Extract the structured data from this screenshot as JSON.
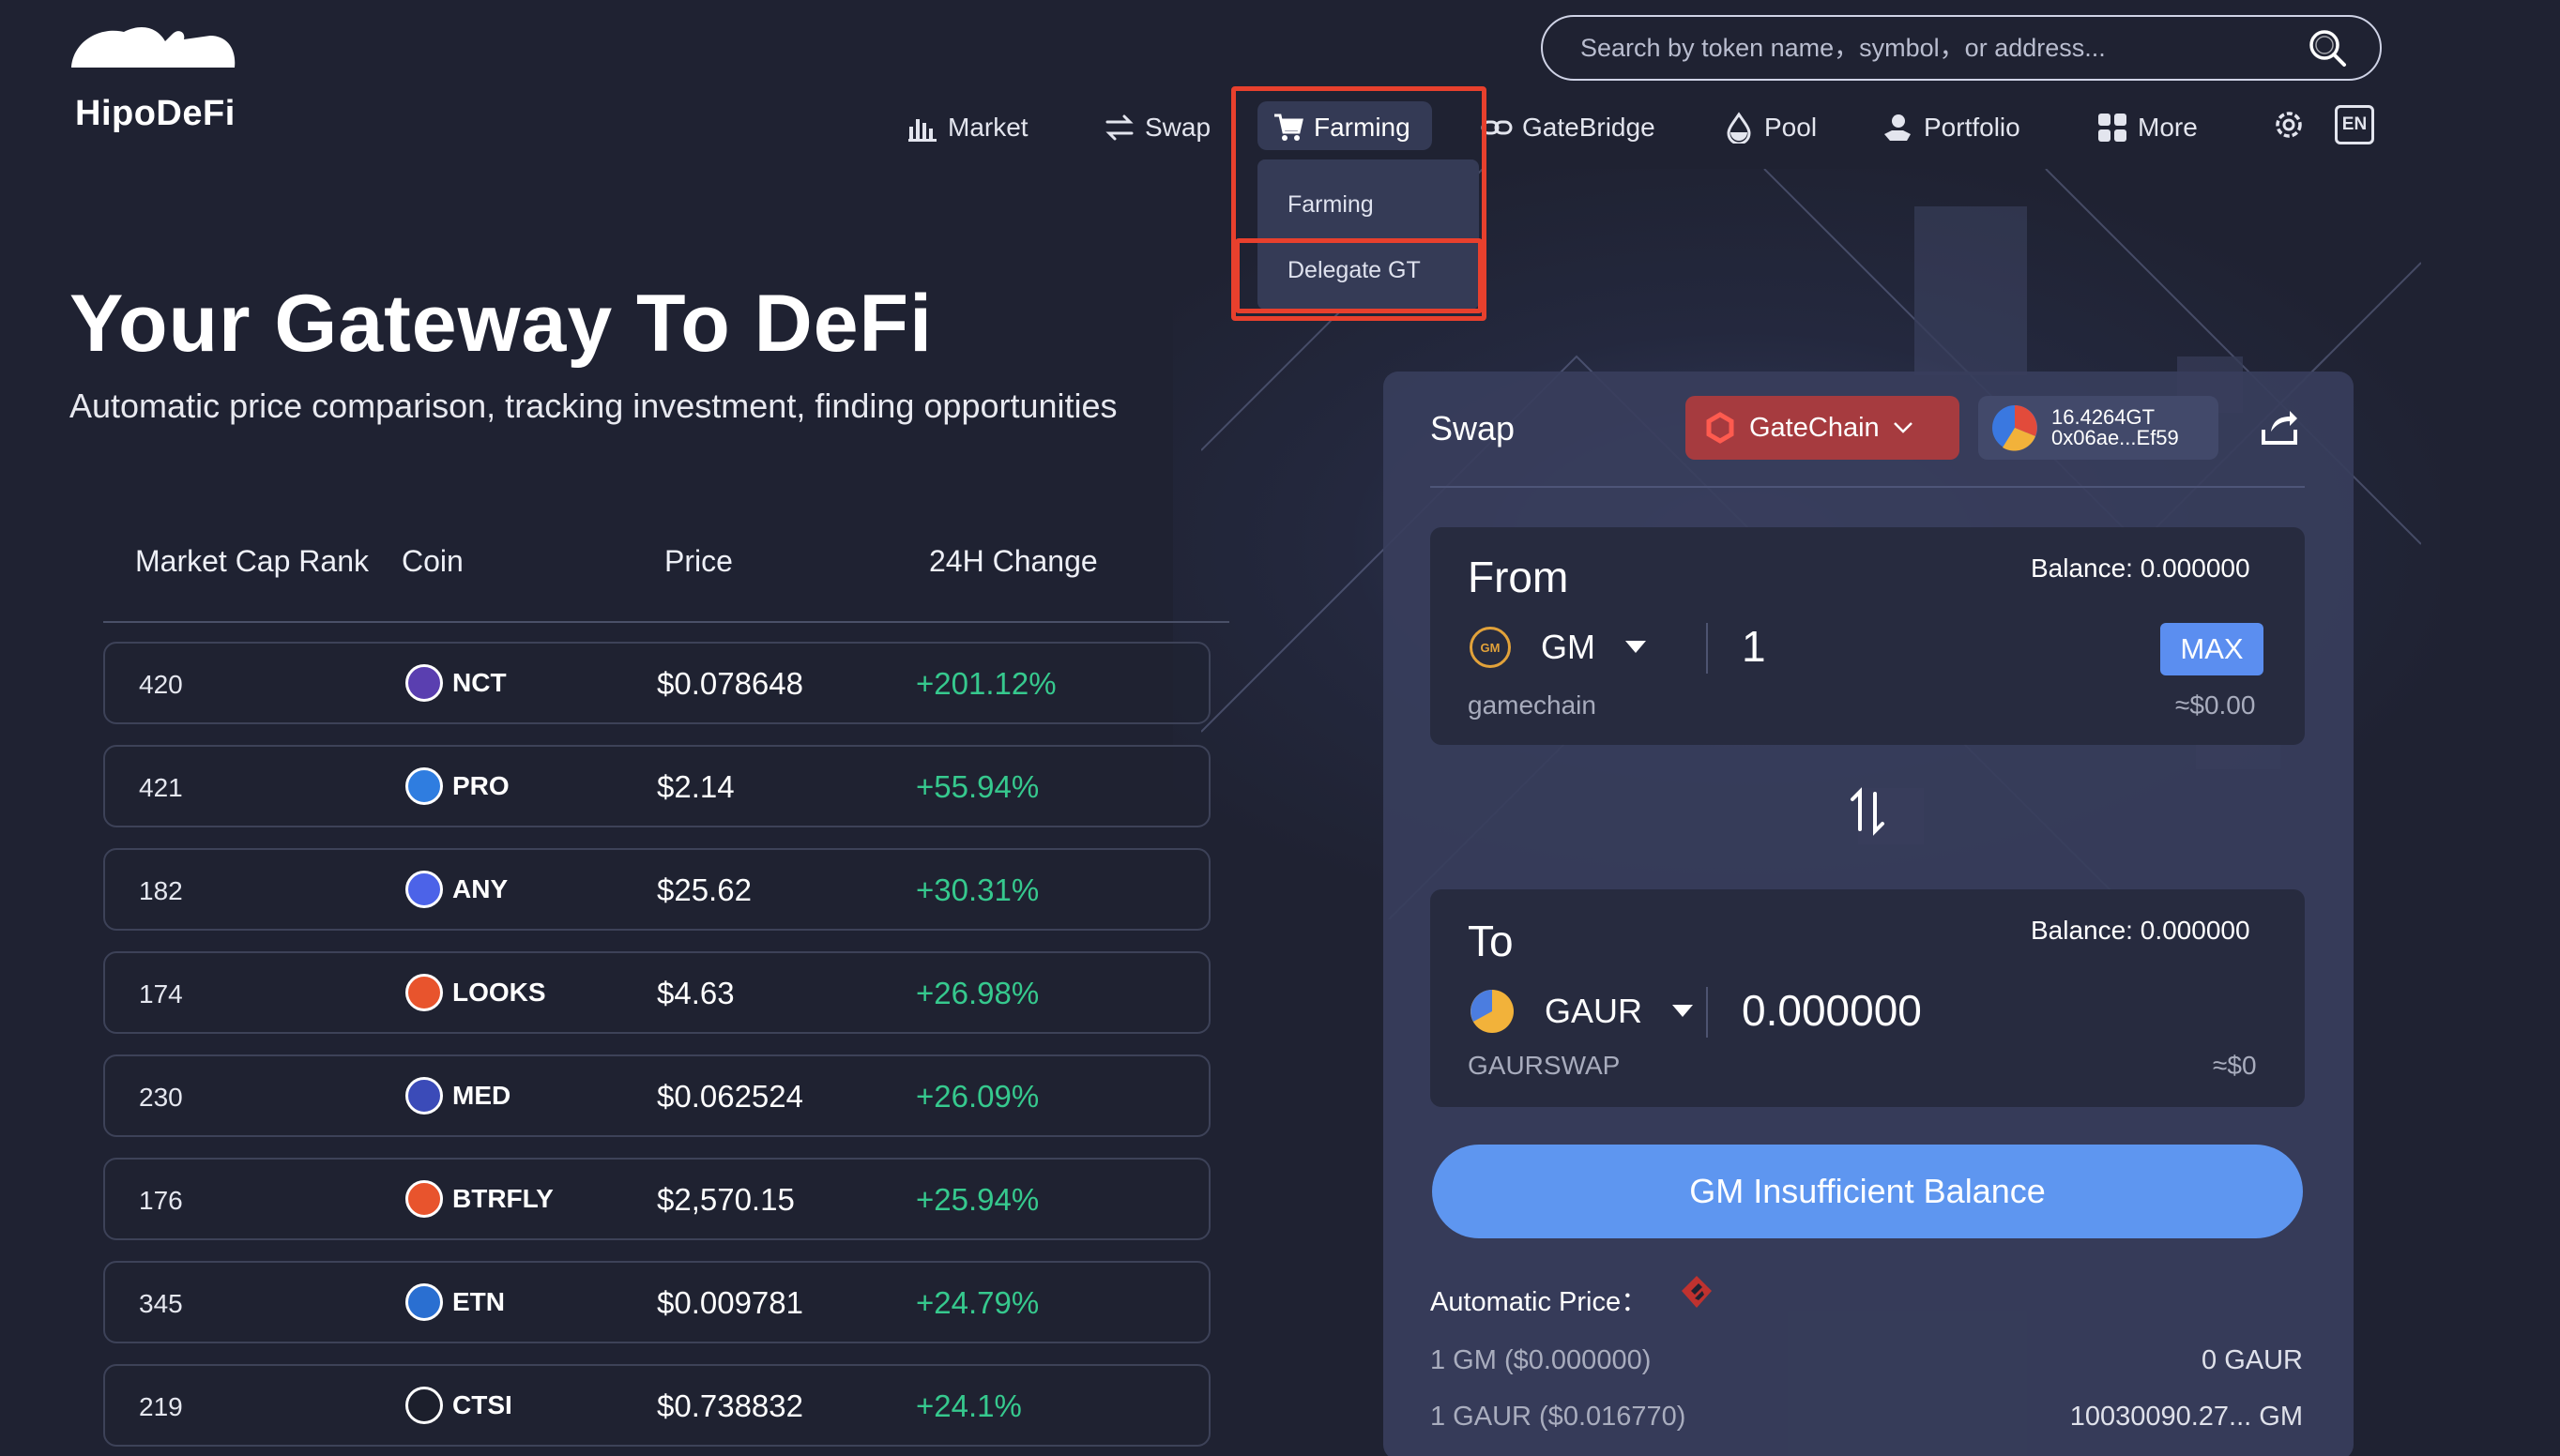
{
  "app": {
    "name": "HipoDeFi"
  },
  "search": {
    "placeholder": "Search by token name，symbol，or address..."
  },
  "nav": {
    "items": [
      {
        "label": "Market",
        "icon": "bar-chart-icon"
      },
      {
        "label": "Swap",
        "icon": "swap-arrows-icon"
      },
      {
        "label": "Farming",
        "icon": "cart-icon",
        "active": true
      },
      {
        "label": "GateBridge",
        "icon": "link-icon"
      },
      {
        "label": "Pool",
        "icon": "drop-icon"
      },
      {
        "label": "Portfolio",
        "icon": "portfolio-hand-icon"
      },
      {
        "label": "More",
        "icon": "grid-icon"
      }
    ],
    "language": "EN",
    "dropdown": {
      "items": [
        "Farming",
        "Delegate GT"
      ]
    }
  },
  "hero": {
    "title": "Your Gateway To DeFi",
    "subtitle": "Automatic price comparison, tracking investment, finding opportunities"
  },
  "market_table": {
    "columns": [
      "Market Cap Rank",
      "Coin",
      "Price",
      "24H Change"
    ],
    "rows": [
      {
        "rank": "420",
        "coin": "NCT",
        "price": "$0.078648",
        "change": "+201.12%",
        "color": "#5a3fb0"
      },
      {
        "rank": "421",
        "coin": "PRO",
        "price": "$2.14",
        "change": "+55.94%",
        "color": "#2f7de0"
      },
      {
        "rank": "182",
        "coin": "ANY",
        "price": "$25.62",
        "change": "+30.31%",
        "color": "#4c63e8"
      },
      {
        "rank": "174",
        "coin": "LOOKS",
        "price": "$4.63",
        "change": "+26.98%",
        "color": "#e8542d"
      },
      {
        "rank": "230",
        "coin": "MED",
        "price": "$0.062524",
        "change": "+26.09%",
        "color": "#3b4bb8"
      },
      {
        "rank": "176",
        "coin": "BTRFLY",
        "price": "$2,570.15",
        "change": "+25.94%",
        "color": "#e8542d"
      },
      {
        "rank": "345",
        "coin": "ETN",
        "price": "$0.009781",
        "change": "+24.79%",
        "color": "#2a6fd1"
      },
      {
        "rank": "219",
        "coin": "CTSI",
        "price": "$0.738832",
        "change": "+24.1%",
        "color": "#1c1f2c"
      }
    ]
  },
  "swap": {
    "title": "Swap",
    "chain": "GateChain",
    "wallet": {
      "balance": "16.4264GT",
      "address": "0x06ae...Ef59"
    },
    "from": {
      "label": "From",
      "balance": "Balance: 0.000000",
      "token": "GM",
      "token_sub": "gamechain",
      "amount": "1",
      "usd": "≈$0.00",
      "max_label": "MAX"
    },
    "to": {
      "label": "To",
      "balance": "Balance: 0.000000",
      "token": "GAUR",
      "token_sub": "GAURSWAP",
      "amount": "0.000000",
      "usd": "≈$0"
    },
    "cta": "GM Insufficient Balance",
    "automatic_price_label": "Automatic Price：",
    "rates": [
      {
        "left": "1 GM ($0.000000)",
        "right": "0 GAUR"
      },
      {
        "left": "1 GAUR ($0.016770)",
        "right": "10030090.27... GM"
      }
    ]
  },
  "colors": {
    "background": "#1f2232",
    "positive": "#36c98e",
    "accent_blue": "#5e96f0",
    "chain_red": "#a63b3f",
    "highlight_box": "#e8402d"
  }
}
